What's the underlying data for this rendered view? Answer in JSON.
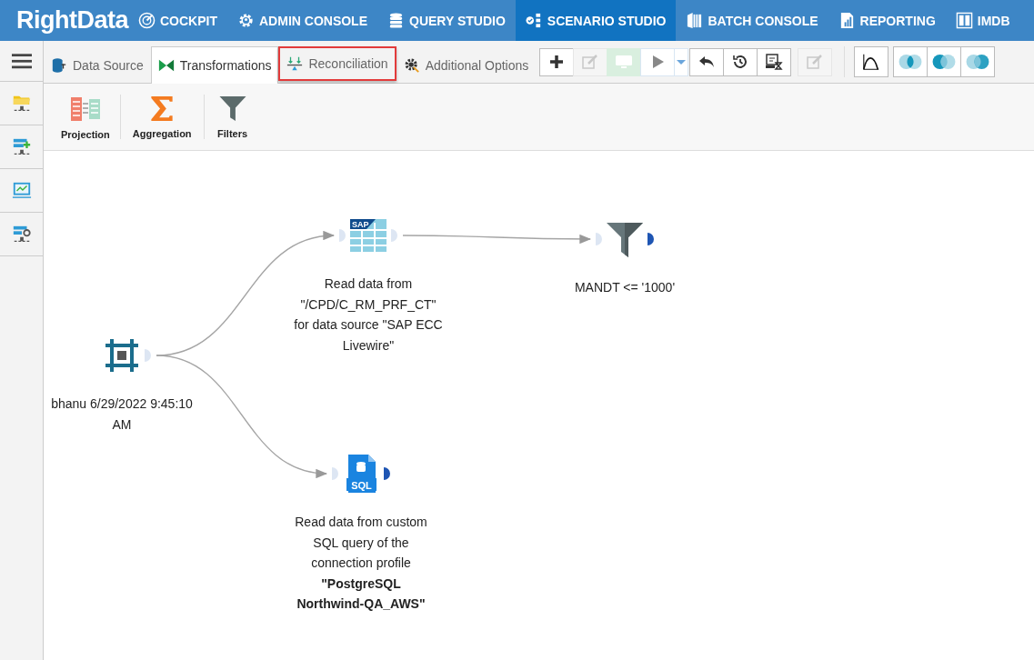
{
  "logo": "RightData",
  "nav": [
    {
      "label": "COCKPIT",
      "selected": false
    },
    {
      "label": "ADMIN CONSOLE",
      "selected": false
    },
    {
      "label": "QUERY STUDIO",
      "selected": false
    },
    {
      "label": "SCENARIO STUDIO",
      "selected": true
    },
    {
      "label": "BATCH CONSOLE",
      "selected": false
    },
    {
      "label": "REPORTING",
      "selected": false
    },
    {
      "label": "IMDB",
      "selected": false
    }
  ],
  "tabs": [
    {
      "label": "Data Source",
      "selected": false,
      "highlighted": false
    },
    {
      "label": "Transformations",
      "selected": true,
      "highlighted": false
    },
    {
      "label": "Reconciliation",
      "selected": false,
      "highlighted": true
    },
    {
      "label": "Additional Options",
      "selected": false,
      "highlighted": false
    }
  ],
  "toolbar": [
    {
      "kind": "add",
      "disabled": false
    },
    {
      "kind": "edit",
      "disabled": true
    },
    {
      "kind": "monitor",
      "disabled": true
    },
    {
      "kind": "play",
      "disabled": true
    },
    {
      "kind": "caret"
    },
    {
      "kind": "undo",
      "disabled": false
    },
    {
      "kind": "history",
      "disabled": false
    },
    {
      "kind": "schedule",
      "disabled": false
    },
    {
      "kind": "edit",
      "disabled": true
    }
  ],
  "view_buttons": [
    {
      "kind": "chart"
    },
    {
      "kind": "venn-inner"
    },
    {
      "kind": "venn-left"
    },
    {
      "kind": "venn-right"
    }
  ],
  "palette": [
    {
      "label": "Projection"
    },
    {
      "label": "Aggregation"
    },
    {
      "label": "Filters"
    }
  ],
  "nodes": [
    {
      "kind": "start",
      "label": "bhanu 6/29/2022 9:45:10 AM",
      "output_linked": true
    },
    {
      "kind": "sap",
      "badge": "SAP",
      "label": "Read data from \"/CPD/C_RM_PRF_CT\" for data source \"SAP ECC Livewire\"",
      "output_linked": true
    },
    {
      "kind": "filter",
      "label": "MANDT <= '1000'",
      "output_linked": false
    },
    {
      "kind": "sql",
      "badge": "SQL",
      "label": "Read data from custom SQL query of the connection profile **\"PostgreSQL Northwind-QA_AWS\"**",
      "output_linked": false
    }
  ]
}
